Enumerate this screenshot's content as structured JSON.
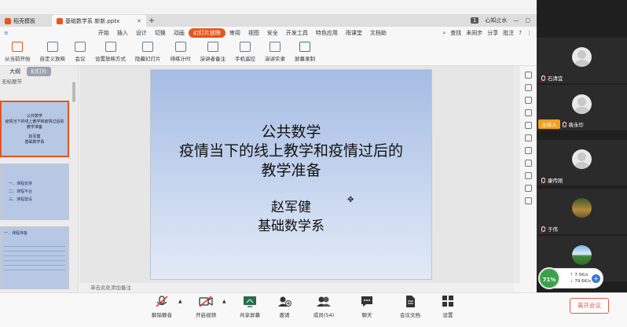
{
  "tabs": {
    "templates": "稻壳模板",
    "document": "基础数学系 新新.pptx",
    "add": "+"
  },
  "window": {
    "badge": "1",
    "user": "心知止水"
  },
  "menu": {
    "items": [
      "开始",
      "插入",
      "设计",
      "切换",
      "动画",
      "幻灯片放映",
      "审阅",
      "视图",
      "安全",
      "开发工具",
      "特色应用",
      "雨课堂",
      "文档助"
    ],
    "active": "幻灯片放映",
    "search": "查找",
    "sync": "未同步",
    "share": "分享",
    "comment": "批注"
  },
  "ribbon": {
    "from_current": "从当前开始",
    "custom_show": "自定义放映",
    "meeting": "会议",
    "setup_show": "设置放映方式",
    "hide_slide": "隐藏幻灯片",
    "rehearse": "排练计时",
    "speaker_notes": "演讲者备注",
    "phone_remote": "手机遥控",
    "record": "演讲实录",
    "screen_record": "屏幕录制"
  },
  "left_panel": {
    "outline_tab": "大纲",
    "slides_tab": "幻灯片",
    "section": "无标题节",
    "thumb1": [
      "公共数学",
      "疫情当下的线上教学和疫情过后的",
      "教学准备",
      "赵军健",
      "基础数学系"
    ],
    "thumb2": [
      "一、课程安排",
      "二、课程平台",
      "三、课程建设"
    ],
    "thumb3": [
      "一、课程准备"
    ]
  },
  "slide": {
    "line1": "公共数学",
    "line2": "疫情当下的线上教学和疫情过后的",
    "line3": "教学准备",
    "line4": "赵军健",
    "line5": "基础数学系"
  },
  "notes": "单击此处添加备注",
  "participants": [
    {
      "name": "石清宜",
      "host": false
    },
    {
      "name": "裴永珍",
      "host": true,
      "host_label": "主持人"
    },
    {
      "name": "康传刚",
      "host": false
    },
    {
      "name": "于伟",
      "host": false
    },
    {
      "name": "",
      "host": false
    }
  ],
  "network": {
    "quality": "71%",
    "up": "7.5K/s",
    "down": "79.6K/s"
  },
  "toolbar": {
    "mute": "解除静音",
    "video": "开启视频",
    "share": "共享屏幕",
    "invite": "邀请",
    "members": "成员(54)",
    "chat": "聊天",
    "docs": "会议文档",
    "settings": "设置",
    "leave": "离开会议"
  },
  "colors": {
    "accent": "#e8541a",
    "host_badge": "#f0a020",
    "leave": "#e05a4a",
    "network_ok": "#3aa34a"
  }
}
